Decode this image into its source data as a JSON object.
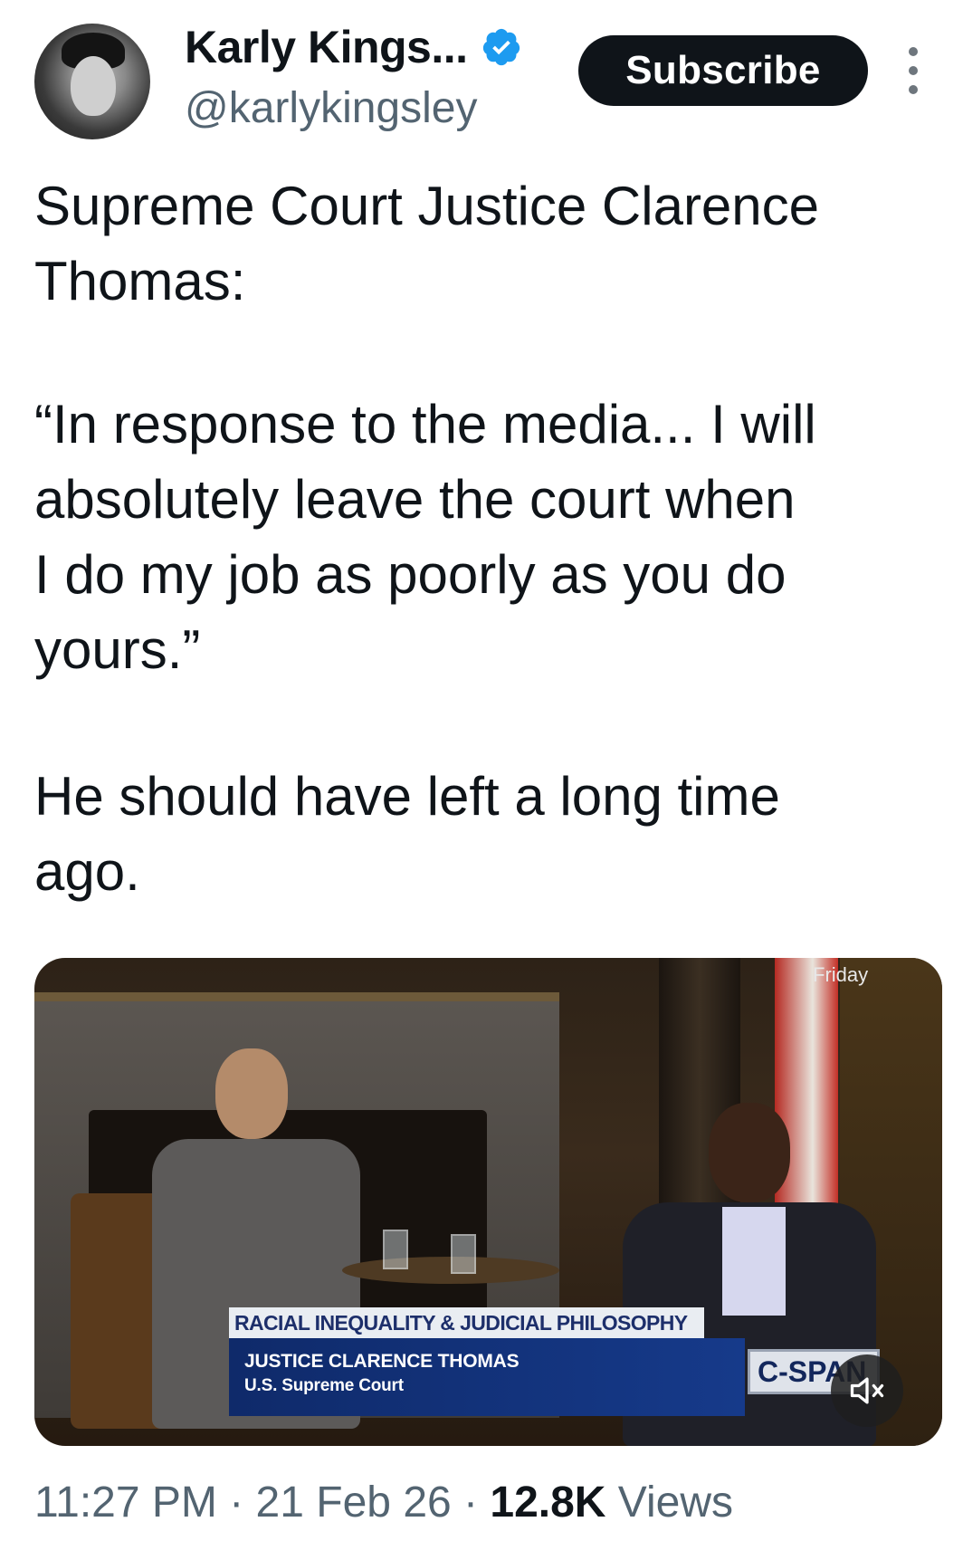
{
  "author": {
    "name": "Karly Kings...",
    "handle": "@karlykingsley",
    "verified_icon": "verified-badge-icon",
    "avatar_icon": "profile-photo"
  },
  "actions": {
    "subscribe_label": "Subscribe",
    "more_icon": "more-vertical-icon"
  },
  "tweet": {
    "paragraph_1": "Supreme Court Justice Clarence\nThomas:",
    "paragraph_2": "“In response to the media... I will\nabsolutely leave the court when\nI do my job as poorly as you do\nyours.”",
    "paragraph_3": "He should have left a long time\nago."
  },
  "media": {
    "corner_label": "Friday",
    "lower_third_topic": "RACIAL INEQUALITY & JUDICIAL PHILOSOPHY",
    "lower_third_name": "JUSTICE CLARENCE THOMAS",
    "lower_third_title": "U.S. Supreme Court",
    "network_logo": "C-SPAN",
    "mute_icon": "muted-speaker-icon"
  },
  "meta": {
    "time": "11:27 PM",
    "separator": " · ",
    "date": "21 Feb 26",
    "views_count": "12.8K",
    "views_label": " Views"
  },
  "colors": {
    "text_primary": "#0f1419",
    "text_secondary": "#536471",
    "verified_blue": "#1d9bf0",
    "subscribe_bg": "#0f1419"
  }
}
